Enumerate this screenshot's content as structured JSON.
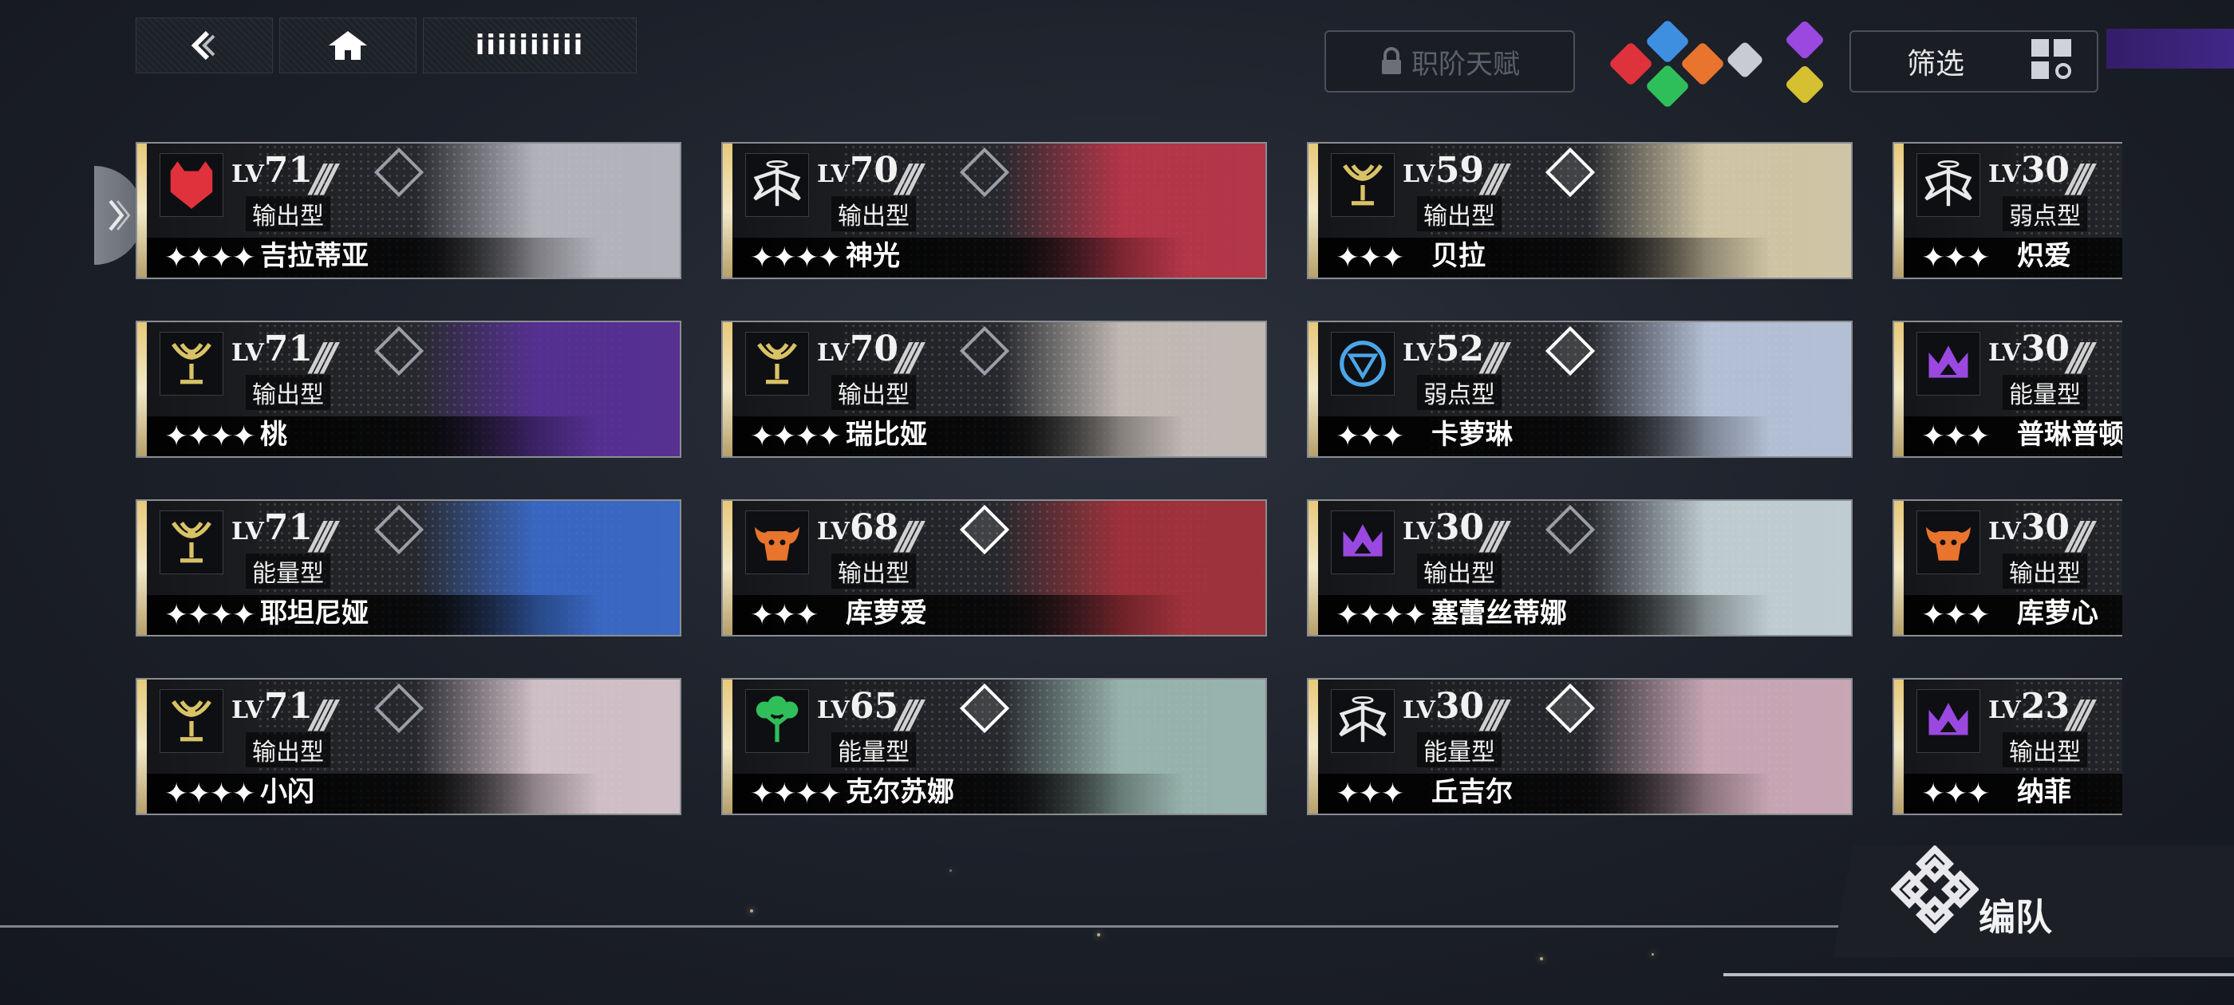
{
  "nav": {
    "title": "iiiiiiiiii"
  },
  "toolbar": {
    "talent_label": "职阶天赋",
    "filter_label": "筛选"
  },
  "elements_colors": [
    "#e0323c",
    "#3e8fe0",
    "#e8742e",
    "#2fbf5a",
    "#9a48e0",
    "#d4c030",
    "#c8ccd2"
  ],
  "characters": [
    {
      "level": "71",
      "type": "输出型",
      "name": "吉拉蒂亚",
      "stars": "✦✦✦✦",
      "emblem": "wolf-icon",
      "emblem_color": "#e0323c",
      "art": "#c8c8d0",
      "diamond_on": false
    },
    {
      "level": "70",
      "type": "输出型",
      "name": "神光",
      "stars": "✦✦✦✦",
      "emblem": "wings-icon",
      "emblem_color": "#e9e9e9",
      "art": "#c8354a",
      "diamond_on": false
    },
    {
      "level": "59",
      "type": "输出型",
      "name": "贝拉",
      "stars": "✦✦✦",
      "emblem": "chalice-icon",
      "emblem_color": "#d8c266",
      "art": "#e9dcb6",
      "diamond_on": true
    },
    {
      "level": "30",
      "type": "弱点型",
      "name": "炽爱",
      "stars": "✦✦✦",
      "emblem": "wings-icon",
      "emblem_color": "#e9e9e9",
      "art": "#5a5a6a",
      "diamond_on": false
    },
    {
      "level": "71",
      "type": "输出型",
      "name": "桃",
      "stars": "✦✦✦✦",
      "emblem": "chalice-icon",
      "emblem_color": "#d8c266",
      "art": "#5a2fa0",
      "diamond_on": false
    },
    {
      "level": "70",
      "type": "输出型",
      "name": "瑞比娅",
      "stars": "✦✦✦✦",
      "emblem": "chalice-icon",
      "emblem_color": "#d8c266",
      "art": "#d8cfc8",
      "diamond_on": false
    },
    {
      "level": "52",
      "type": "弱点型",
      "name": "卡萝琳",
      "stars": "✦✦✦",
      "emblem": "shield-icon",
      "emblem_color": "#4aa6e8",
      "art": "#c8d6ee",
      "diamond_on": true
    },
    {
      "level": "30",
      "type": "能量型",
      "name": "普琳普顿",
      "stars": "✦✦✦",
      "emblem": "crown-icon",
      "emblem_color": "#9a48e0",
      "art": "#5a5a6a",
      "diamond_on": false
    },
    {
      "level": "71",
      "type": "能量型",
      "name": "耶坦尼娅",
      "stars": "✦✦✦✦",
      "emblem": "chalice-icon",
      "emblem_color": "#d8c266",
      "art": "#3a6fd8",
      "diamond_on": false
    },
    {
      "level": "68",
      "type": "输出型",
      "name": "库萝爱",
      "stars": "✦✦✦",
      "emblem": "ox-icon",
      "emblem_color": "#e8742e",
      "art": "#b0303a",
      "diamond_on": true
    },
    {
      "level": "30",
      "type": "输出型",
      "name": "塞蕾丝蒂娜",
      "stars": "✦✦✦✦",
      "emblem": "crown-icon",
      "emblem_color": "#9a48e0",
      "art": "#d6e6ea",
      "diamond_on": false
    },
    {
      "level": "30",
      "type": "输出型",
      "name": "库萝心",
      "stars": "✦✦✦",
      "emblem": "ox-icon",
      "emblem_color": "#e8742e",
      "art": "#5a5a6a",
      "diamond_on": false
    },
    {
      "level": "71",
      "type": "输出型",
      "name": "小闪",
      "stars": "✦✦✦✦",
      "emblem": "chalice-icon",
      "emblem_color": "#d8c266",
      "art": "#ead6de",
      "diamond_on": false
    },
    {
      "level": "65",
      "type": "能量型",
      "name": "克尔苏娜",
      "stars": "✦✦✦✦",
      "emblem": "tree-icon",
      "emblem_color": "#2fbf5a",
      "art": "#a8c8c0",
      "diamond_on": true
    },
    {
      "level": "30",
      "type": "能量型",
      "name": "丘吉尔",
      "stars": "✦✦✦",
      "emblem": "wings-icon",
      "emblem_color": "#e9e9e9",
      "art": "#e0b8c8",
      "diamond_on": true
    },
    {
      "level": "23",
      "type": "输出型",
      "name": "纳菲",
      "stars": "✦✦✦",
      "emblem": "crown-icon",
      "emblem_color": "#9a48e0",
      "art": "#d8a0b8",
      "diamond_on": false
    }
  ],
  "formation": {
    "label": "编队"
  }
}
